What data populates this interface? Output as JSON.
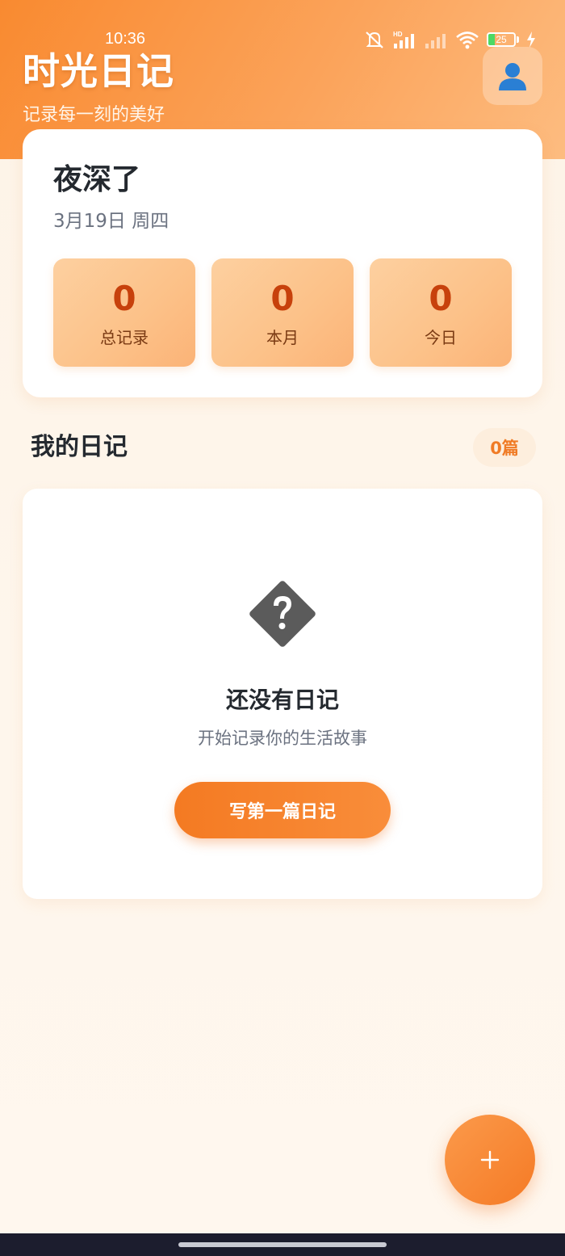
{
  "status_bar": {
    "time": "10:36",
    "battery_level": "25",
    "icons": [
      "mute-icon",
      "hd-signal-icon",
      "signal-icon",
      "wifi-icon",
      "battery-icon",
      "charging-icon"
    ]
  },
  "header": {
    "title": "时光日记",
    "subtitle": "记录每一刻的美好",
    "avatar_icon": "person-icon"
  },
  "summary": {
    "greeting": "夜深了",
    "date": "3月19日 周四",
    "stats": [
      {
        "value": "0",
        "label": "总记录"
      },
      {
        "value": "0",
        "label": "本月"
      },
      {
        "value": "0",
        "label": "今日"
      }
    ]
  },
  "diary_section": {
    "title": "我的日记",
    "count": "0篇"
  },
  "empty_state": {
    "icon": "question-diamond-icon",
    "title": "还没有日记",
    "subtitle": "开始记录你的生活故事",
    "button_label": "写第一篇日记"
  },
  "fab": {
    "icon": "plus-icon"
  },
  "colors": {
    "accent": "#f57a25",
    "stat_value": "#c7410c",
    "background": "#fdf3e7"
  }
}
